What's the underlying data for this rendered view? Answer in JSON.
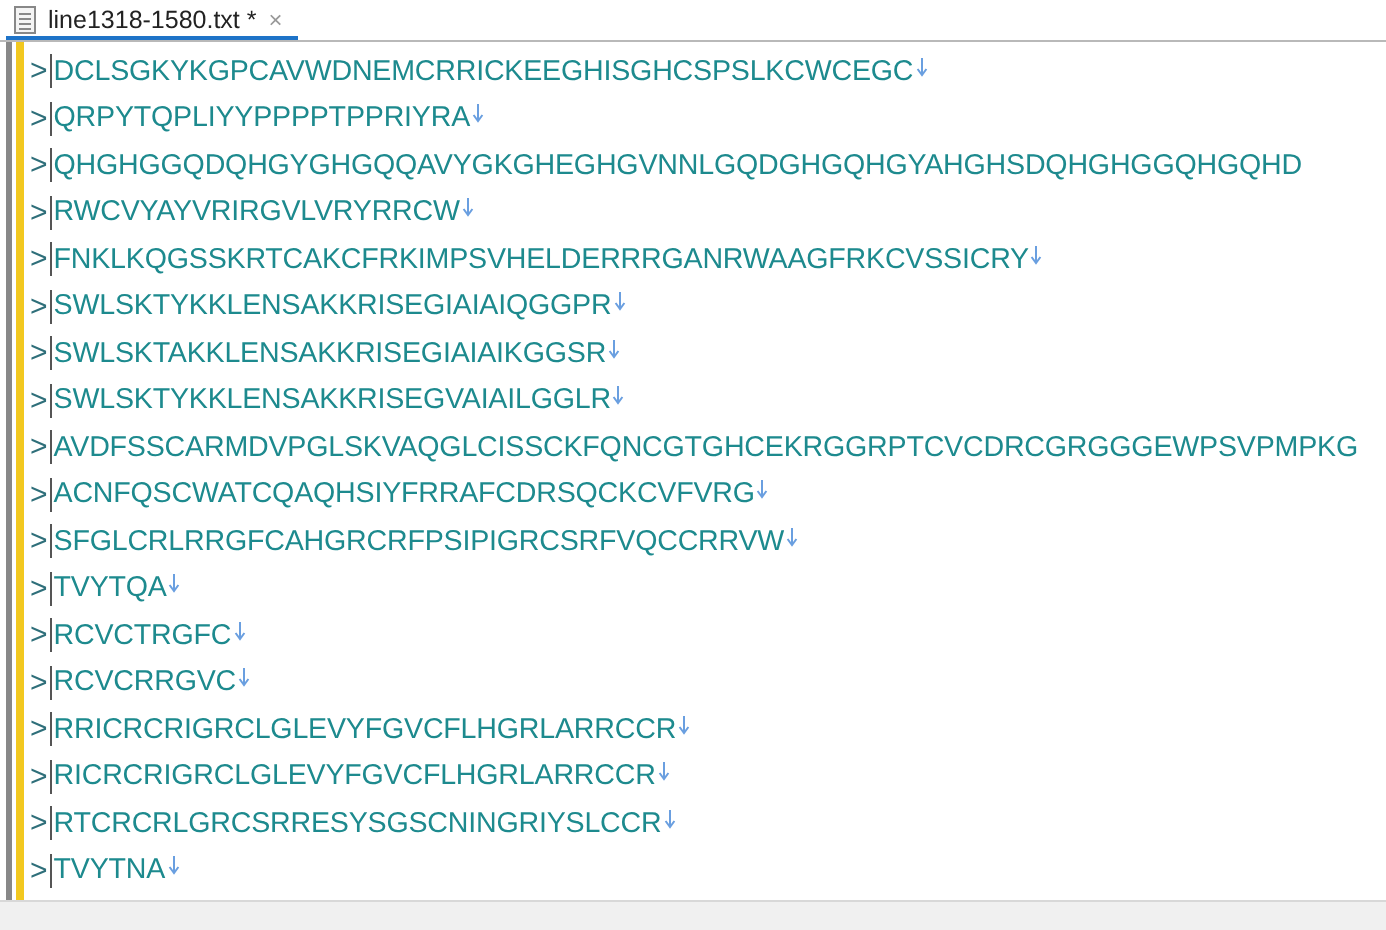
{
  "tab": {
    "title": "line1318-1580.txt *",
    "close": "×",
    "selected": true
  },
  "lines": [
    {
      "prefix": ">",
      "text": "DCLSGKYKGPCAVWDNEMCRRICKEEGHISGHCSPSLKCWCEGC",
      "eol": true
    },
    {
      "prefix": ">",
      "text": "QRPYTQPLIYYPPPPTPPRIYRA",
      "eol": true
    },
    {
      "prefix": ">",
      "text": "QHGHGGQDQHGYGHGQQAVYGKGHEGHGVNNLGQDGHGQHGYAHGHSDQHGHGGQHGQHD",
      "eol": false
    },
    {
      "prefix": ">",
      "text": "RWCVYAYVRIRGVLVRYRRCW",
      "eol": true
    },
    {
      "prefix": ">",
      "text": "FNKLKQGSSKRTCAKCFRKIMPSVHELDERRRGANRWAAGFRKCVSSICRY",
      "eol": true
    },
    {
      "prefix": ">",
      "text": "SWLSKTYKKLENSAKKRISEGIAIAIQGGPR",
      "eol": true
    },
    {
      "prefix": ">",
      "text": "SWLSKTAKKLENSAKKRISEGIAIAIKGGSR",
      "eol": true
    },
    {
      "prefix": ">",
      "text": "SWLSKTYKKLENSAKKRISEGVAIAILGGLR",
      "eol": true
    },
    {
      "prefix": ">",
      "text": "AVDFSSCARMDVPGLSKVAQGLCISSCKFQNCGTGHCEKRGGRPTCVCDRCGRGGGEWPSVPMPKG",
      "eol": false
    },
    {
      "prefix": ">",
      "text": "ACNFQSCWATCQAQHSIYFRRAFCDRSQCKCVFVRG",
      "eol": true
    },
    {
      "prefix": ">",
      "text": "SFGLCRLRRGFCAHGRCRFPSIPIGRCSRFVQCCRRVW",
      "eol": true
    },
    {
      "prefix": ">",
      "text": "TVYTQA",
      "eol": true
    },
    {
      "prefix": ">",
      "text": "RCVCTRGFC",
      "eol": true
    },
    {
      "prefix": ">",
      "text": "RCVCRRGVC",
      "eol": true
    },
    {
      "prefix": ">",
      "text": "RRICRCRIGRCLGLEVYFGVCFLHGRLARRCCR",
      "eol": true
    },
    {
      "prefix": ">",
      "text": "RICRCRIGRCLGLEVYFGVCFLHGRLARRCCR",
      "eol": true
    },
    {
      "prefix": ">",
      "text": "RTCRCRLGRCSRRESYSGSCNINGRIYSLCCR",
      "eol": true
    },
    {
      "prefix": ">",
      "text": "TVYTNA",
      "eol": true
    }
  ]
}
